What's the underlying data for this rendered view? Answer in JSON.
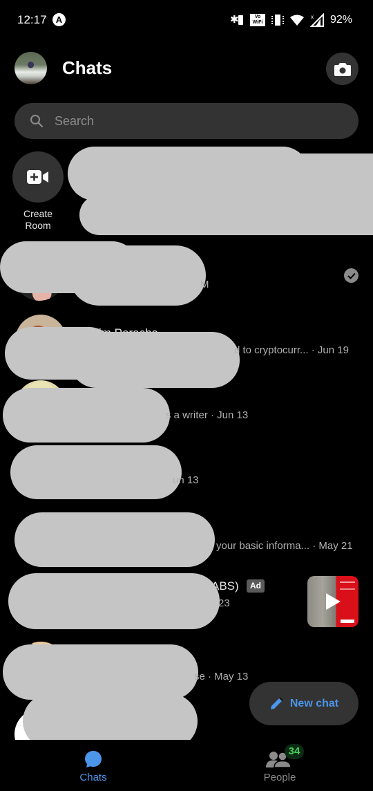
{
  "status_bar": {
    "time": "12:17",
    "notification_icon": "a-circle-icon",
    "icons": [
      "bluetooth-battery-icon",
      "volte-wifi-icon",
      "vibrate-icon",
      "wifi-icon",
      "cell-signal-icon"
    ],
    "volte_label": "Vo WiFi",
    "battery": "92%"
  },
  "header": {
    "title": "Chats",
    "camera_icon": "camera-icon"
  },
  "search": {
    "placeholder": "Search"
  },
  "create_room": {
    "label_line1": "Create",
    "label_line2": "Room"
  },
  "chats": [
    {
      "name": "",
      "preview": "M",
      "time": "",
      "status": "read"
    },
    {
      "name": "im Peracha",
      "preview": "d to cryptocurr...",
      "time": "· Jun 19"
    },
    {
      "name": "",
      "preview": "s a writer",
      "time": "· Jun 13"
    },
    {
      "name": "",
      "preview": "",
      "time": "un 13"
    },
    {
      "name": "",
      "preview": "your basic informa...",
      "time": "· May 21"
    },
    {
      "name": "ABS)",
      "badge": "Ad",
      "preview": "23",
      "time": "",
      "sponsored": true
    },
    {
      "name": "",
      "preview": "se",
      "time": "· May 13"
    }
  ],
  "fab": {
    "label": "New chat",
    "icon": "pencil-icon"
  },
  "bottom_nav": {
    "items": [
      {
        "label": "Chats",
        "icon": "chat-bubble-icon",
        "active": true
      },
      {
        "label": "People",
        "icon": "people-icon",
        "badge": "34"
      }
    ]
  },
  "colors": {
    "accent": "#4b95ea",
    "background": "#000000",
    "surface": "#333333",
    "badge_green": "#44d15a",
    "redaction": "#c5c5c5"
  }
}
